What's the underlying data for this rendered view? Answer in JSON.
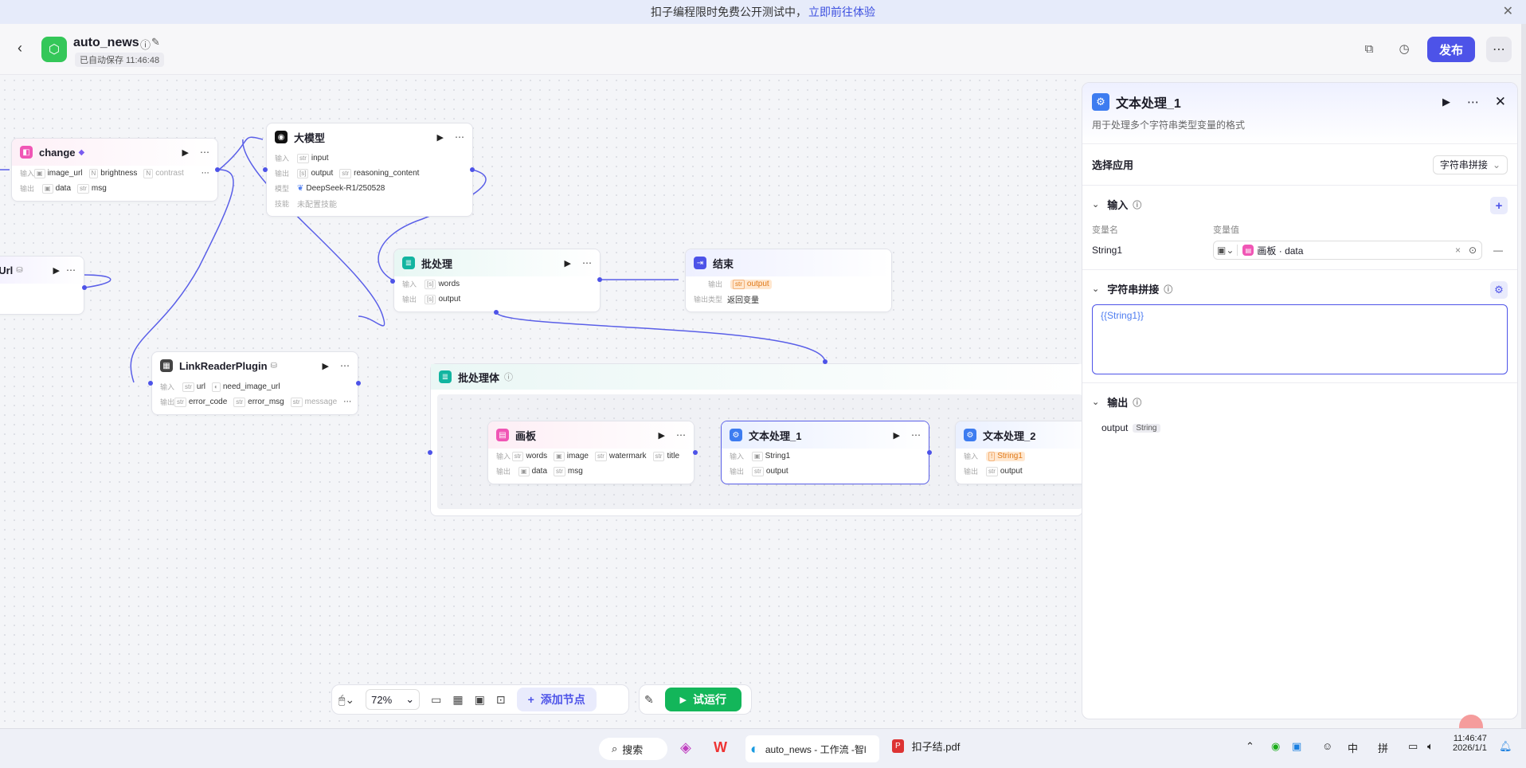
{
  "banner": {
    "text": "扣子编程限时免费公开测试中，",
    "link": "立即前往体验"
  },
  "header": {
    "app_name": "auto_news",
    "saved": "已自动保存 11:46:48",
    "publish": "发布"
  },
  "canvas": {
    "nodes": {
      "change": {
        "title": "change",
        "in_label": "输入",
        "out_label": "输出",
        "inputs": [
          "image_url",
          "brightness",
          "contrast"
        ],
        "outputs": [
          "data",
          "msg"
        ]
      },
      "getUrl": {
        "title": "eUrl"
      },
      "llm": {
        "title": "大模型",
        "in_label": "输入",
        "out_label": "输出",
        "model_label": "模型",
        "skill_label": "技能",
        "input": "input",
        "outputs": [
          "output",
          "reasoning_content"
        ],
        "model": "DeepSeek-R1/250528",
        "skill": "未配置技能"
      },
      "batch": {
        "title": "批处理",
        "in_label": "输入",
        "out_label": "输出",
        "input": "words",
        "output": "output"
      },
      "end": {
        "title": "结束",
        "out_label": "输出",
        "out_type_label": "输出类型",
        "output": "output",
        "type": "返回变量"
      },
      "link": {
        "title": "LinkReaderPlugin",
        "in_label": "输入",
        "out_label": "输出",
        "inputs": [
          "url",
          "need_image_url"
        ],
        "outputs": [
          "error_code",
          "error_msg",
          "message"
        ]
      },
      "batch_body": {
        "title": "批处理体"
      },
      "canvas_node": {
        "title": "画板",
        "in_label": "输入",
        "out_label": "输出",
        "inputs": [
          "words",
          "image",
          "watermark",
          "title"
        ],
        "outputs": [
          "data",
          "msg"
        ]
      },
      "text1": {
        "title": "文本处理_1",
        "in_label": "输入",
        "out_label": "输出",
        "input": "String1",
        "output": "output"
      },
      "text2": {
        "title": "文本处理_2",
        "in_label": "输入",
        "out_label": "输出",
        "input": "String1",
        "output": "output"
      }
    }
  },
  "toolbar": {
    "zoom": "72%",
    "add_node": "添加节点",
    "test_run": "试运行"
  },
  "panel": {
    "title": "文本处理_1",
    "description": "用于处理多个字符串类型变量的格式",
    "select_app_label": "选择应用",
    "select_app_value": "字符串拼接",
    "input_title": "输入",
    "var_name_header": "变量名",
    "var_value_header": "变量值",
    "var_name": "String1",
    "var_value": "画板 · data",
    "concat_title": "字符串拼接",
    "template": "{{String1}}",
    "output_title": "输出",
    "output_name": "output",
    "output_type": "String"
  },
  "taskbar": {
    "search": "搜索",
    "browser_tab": "auto_news - 工作流 -智l",
    "pdf": "扣子结.pdf",
    "ime1": "中",
    "ime2": "拼",
    "time": "11:46:47",
    "date": "2026/1/1"
  }
}
